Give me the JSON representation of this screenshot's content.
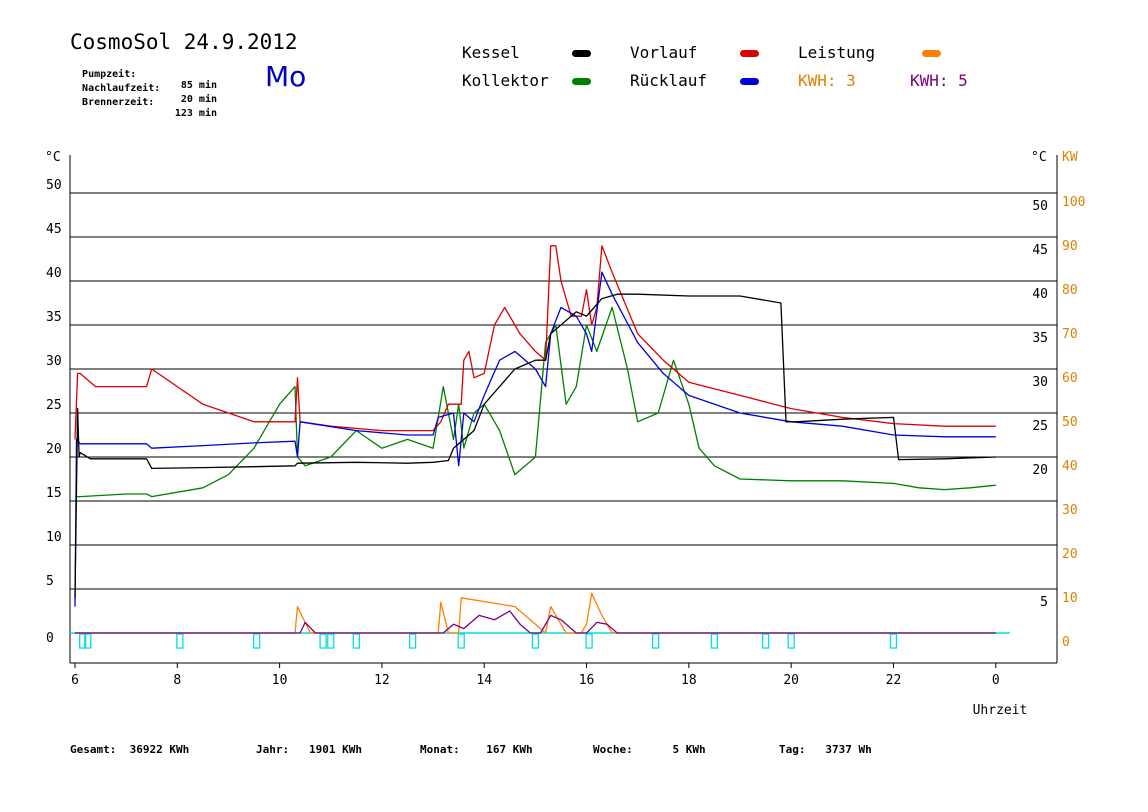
{
  "header": {
    "title": "CosmoSol 24.9.2012",
    "day": "Mo",
    "pumpzeit_label": "Pumpzeit:",
    "pumpzeit_value": "85 min",
    "nachlauf_label": "Nachlaufzeit:",
    "nachlauf_value": "20 min",
    "brenner_label": "Brennerzeit:",
    "brenner_value": "123 min"
  },
  "legend": {
    "kessel": "Kessel",
    "kollektor": "Kollektor",
    "vorlauf": "Vorlauf",
    "ruecklauf": "Rücklauf",
    "leistung": "Leistung",
    "kwh1": "KWH: 3",
    "kwh2": "KWH: 5"
  },
  "colors": {
    "kessel": "#000000",
    "vorlauf": "#dd0000",
    "ruecklauf": "#0000dd",
    "kollektor": "#008000",
    "leistung": "#ff8000",
    "kwh2": "#800080",
    "pumpe": "#00e0e0",
    "right_axis": "#e08000"
  },
  "footer": {
    "gesamt_label": "Gesamt:",
    "gesamt_value": "36922 KWh",
    "jahr_label": "Jahr:",
    "jahr_value": "1901 KWh",
    "monat_label": "Monat:",
    "monat_value": "167 KWh",
    "woche_label": "Woche:",
    "woche_value": "5 KWh",
    "tag_label": "Tag:",
    "tag_value": "3737 Wh"
  },
  "chart_data": {
    "type": "line",
    "title": "CosmoSol 24.9.2012",
    "xlabel": "Uhrzeit",
    "y_left_label": "°C",
    "y_right_labels": [
      "°C",
      "KW"
    ],
    "x_ticks": [
      "6",
      "8",
      "10",
      "12",
      "14",
      "16",
      "18",
      "20",
      "22",
      "0"
    ],
    "y_ticks": [
      "0",
      "5",
      "10",
      "15",
      "20",
      "25",
      "30",
      "35",
      "40",
      "45",
      "50"
    ],
    "y_right_ticks": [
      "5",
      "20",
      "25",
      "30",
      "35",
      "40",
      "45",
      "50"
    ],
    "kw_ticks": [
      "0",
      "10",
      "20",
      "30",
      "40",
      "50",
      "60",
      "70",
      "80",
      "90",
      "100"
    ],
    "xlim": [
      6,
      24.2
    ],
    "ylim": [
      0,
      55
    ],
    "grid": true,
    "series": [
      {
        "name": "Vorlauf",
        "key": "vorlauf",
        "x": [
          6.0,
          6.05,
          6.1,
          6.4,
          7.4,
          7.5,
          8.0,
          8.5,
          9.0,
          9.5,
          10.3,
          10.35,
          10.4,
          11.0,
          12.0,
          13.0,
          13.15,
          13.3,
          13.55,
          13.6,
          13.7,
          13.8,
          14.0,
          14.2,
          14.4,
          14.5,
          14.7,
          15.0,
          15.2,
          15.3,
          15.4,
          15.5,
          15.7,
          15.9,
          16.0,
          16.1,
          16.2,
          16.3,
          16.5,
          17.0,
          17.5,
          18.0,
          19.0,
          20.0,
          21.0,
          22.0,
          23.0,
          24.0
        ],
        "y": [
          22,
          29.5,
          29.5,
          28,
          28,
          30,
          28,
          26,
          25,
          24,
          24,
          29,
          24,
          23.5,
          23,
          23,
          24,
          26,
          26,
          31,
          32,
          29,
          29.5,
          35,
          37,
          36,
          34,
          32,
          31,
          44,
          44,
          40,
          36,
          36,
          39,
          35,
          37,
          44,
          41,
          34,
          31,
          28.5,
          27,
          25.5,
          24.5,
          23.8,
          23.5,
          23.5
        ]
      },
      {
        "name": "Rücklauf",
        "key": "ruecklauf",
        "x": [
          6.0,
          6.03,
          6.1,
          7.4,
          7.5,
          8.5,
          9.5,
          10.3,
          10.35,
          10.4,
          11.5,
          12.5,
          13.0,
          13.1,
          13.4,
          13.5,
          13.6,
          13.8,
          14.0,
          14.3,
          14.6,
          14.8,
          15.0,
          15.2,
          15.3,
          15.5,
          15.8,
          16.0,
          16.1,
          16.3,
          16.5,
          17.0,
          17.5,
          18.0,
          19.0,
          20.0,
          21.0,
          22.0,
          23.0,
          24.0
        ],
        "y": [
          3,
          22,
          21.5,
          21.5,
          21,
          21.3,
          21.6,
          21.8,
          20,
          24,
          23,
          22.5,
          22.5,
          24.5,
          25,
          19,
          25,
          24,
          27,
          31,
          32,
          31,
          30,
          28,
          34,
          37,
          36,
          34,
          32,
          41,
          38.5,
          33,
          29.5,
          27,
          25,
          24,
          23.5,
          22.5,
          22.3,
          22.3
        ]
      },
      {
        "name": "Kessel",
        "key": "kessel",
        "x": [
          6.0,
          6.05,
          6.08,
          6.1,
          6.3,
          7.4,
          7.5,
          8.5,
          9.5,
          10.3,
          10.35,
          11.5,
          12.5,
          13.0,
          13.3,
          13.4,
          13.6,
          13.8,
          14.0,
          14.3,
          14.6,
          15.0,
          15.2,
          15.3,
          15.8,
          16.0,
          16.3,
          16.6,
          17.0,
          18.0,
          19.0,
          19.8,
          19.9,
          20.1,
          21.0,
          22.0,
          22.1,
          23.0,
          24.0
        ],
        "y": [
          4,
          25.5,
          20,
          20.5,
          19.8,
          19.8,
          18.7,
          18.8,
          18.9,
          19,
          19.3,
          19.4,
          19.3,
          19.4,
          19.6,
          21,
          22,
          23,
          26,
          28,
          30,
          31,
          31,
          34,
          36.5,
          36,
          38,
          38.5,
          38.5,
          38.3,
          38.3,
          37.5,
          24,
          24,
          24.3,
          24.5,
          19.7,
          19.8,
          20
        ]
      },
      {
        "name": "Kollektor",
        "key": "kollektor",
        "x": [
          6.0,
          6.1,
          7.0,
          7.4,
          7.5,
          8.5,
          9.0,
          9.5,
          10.0,
          10.3,
          10.35,
          10.5,
          11.0,
          11.5,
          12.0,
          12.5,
          13.0,
          13.2,
          13.4,
          13.5,
          13.6,
          13.8,
          14.0,
          14.3,
          14.6,
          15.0,
          15.2,
          15.4,
          15.6,
          15.8,
          16.0,
          16.2,
          16.5,
          16.8,
          17.0,
          17.4,
          17.7,
          18.0,
          18.2,
          18.5,
          19.0,
          20.0,
          21.0,
          22.0,
          22.5,
          23.0,
          23.5,
          24.0
        ],
        "y": [
          15.5,
          15.5,
          15.8,
          15.8,
          15.5,
          16.5,
          18,
          21,
          26,
          28,
          20,
          19,
          20,
          23,
          21,
          22,
          21,
          28,
          22,
          26,
          21,
          25,
          26,
          23,
          18,
          20,
          33,
          35,
          26,
          28,
          35,
          32,
          37,
          30,
          24,
          25,
          31,
          26,
          21,
          19,
          17.5,
          17.3,
          17.3,
          17,
          16.5,
          16.3,
          16.5,
          16.8
        ]
      },
      {
        "name": "Leistung",
        "key": "leistung",
        "x": [
          6.0,
          10.3,
          10.35,
          10.6,
          13.1,
          13.15,
          13.3,
          13.5,
          13.55,
          14.6,
          15.2,
          15.3,
          15.6,
          15.9,
          16.0,
          16.1,
          16.3,
          16.5,
          24.0
        ],
        "y": [
          0,
          0,
          3,
          0,
          0,
          3.5,
          0,
          0,
          4,
          3,
          0,
          3,
          0,
          0,
          1,
          4.5,
          2,
          0,
          0
        ]
      },
      {
        "name": "KWH: 5",
        "key": "kwh2",
        "x": [
          6.0,
          10.4,
          10.5,
          10.7,
          13.2,
          13.4,
          13.6,
          13.9,
          14.2,
          14.5,
          14.7,
          14.9,
          15.1,
          15.3,
          15.5,
          15.8,
          16.0,
          16.2,
          16.4,
          16.6,
          24.0
        ],
        "y": [
          0,
          0,
          1.2,
          0,
          0,
          1,
          0.5,
          2,
          1.5,
          2.5,
          1,
          0,
          0,
          2,
          1.5,
          0,
          0,
          1.2,
          1,
          0,
          0
        ]
      },
      {
        "name": "Pumpe",
        "key": "pumpe",
        "x": [
          6.0,
          24.0
        ],
        "y": [
          0,
          0
        ]
      }
    ]
  }
}
